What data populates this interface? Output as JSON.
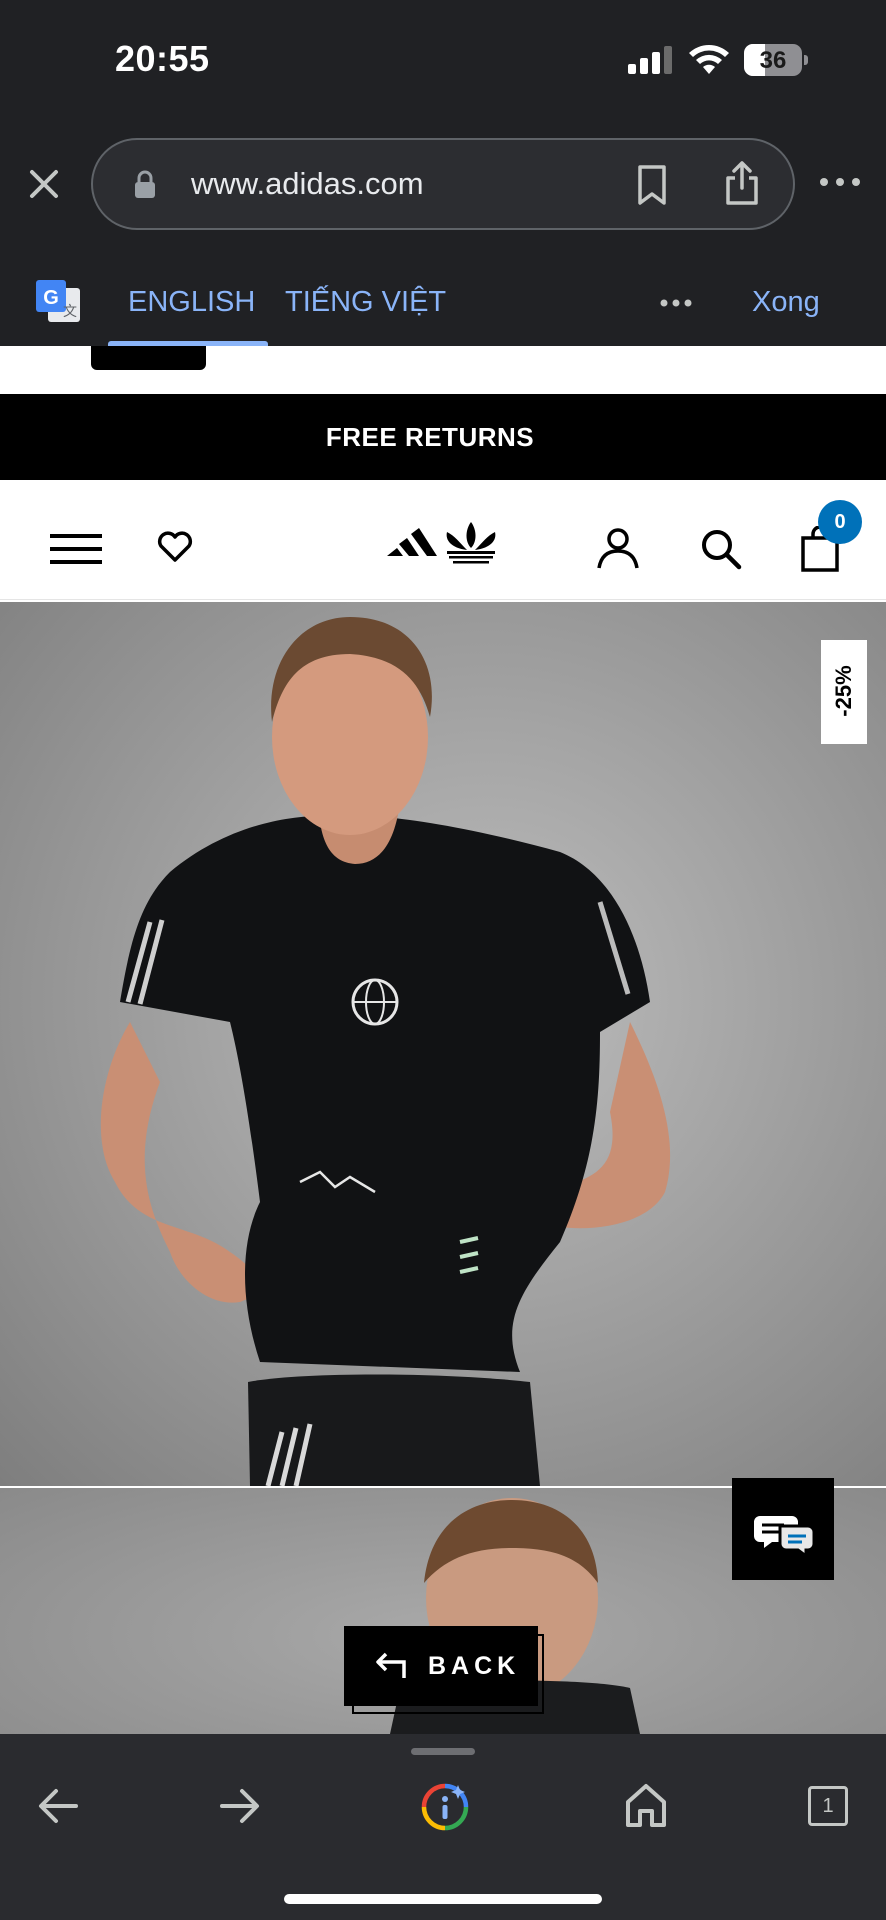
{
  "status_bar": {
    "time": "20:55",
    "battery_percent": "36",
    "battery_level": 0.36
  },
  "browser": {
    "url": "www.adidas.com"
  },
  "translate_bar": {
    "lang_source": "ENGLISH",
    "lang_target": "TIẾNG VIỆT",
    "done_label": "Xong"
  },
  "site": {
    "promo_text": "FREE RETURNS",
    "cart_count": "0",
    "discount_badge": "-25%",
    "back_label": "BACK",
    "colors": {
      "accent_blue": "#0071b9",
      "chrome_bg": "#202124",
      "link_blue": "#8ab4f8"
    }
  },
  "toolbar": {
    "tab_count": "1"
  }
}
